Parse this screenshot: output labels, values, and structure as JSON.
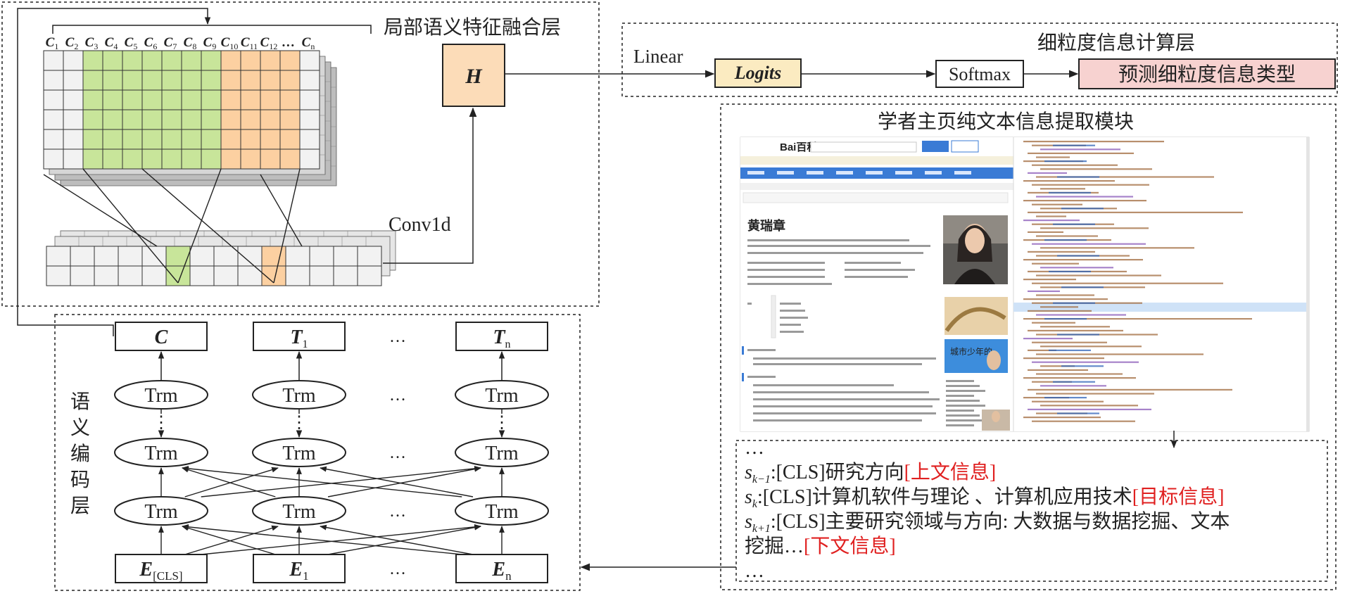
{
  "colors": {
    "green": "#c8e59a",
    "orange": "#fcd0a1",
    "logits_fill": "#fbebc1",
    "predict_fill": "#f7d2d0",
    "h_fill": "#fcdcb8",
    "red_text": "#e02020",
    "gray_cell": "#f2f2f2",
    "stack_gray": "#bdbdbd",
    "stack_gray2": "#d6d6d6",
    "screenshot_blue": "#3a7bd5"
  },
  "fusion": {
    "title": "局部语义特征融合层",
    "conv_label": "Conv1d",
    "h_label": "H",
    "columns": [
      {
        "main": "C",
        "sub": "1"
      },
      {
        "main": "C",
        "sub": "2"
      },
      {
        "main": "C",
        "sub": "3"
      },
      {
        "main": "C",
        "sub": "4"
      },
      {
        "main": "C",
        "sub": "5"
      },
      {
        "main": "C",
        "sub": "6"
      },
      {
        "main": "C",
        "sub": "7"
      },
      {
        "main": "C",
        "sub": "8"
      },
      {
        "main": "C",
        "sub": "9"
      },
      {
        "main": "C",
        "sub": "10"
      },
      {
        "main": "C",
        "sub": "11"
      },
      {
        "main": "C",
        "sub": "12"
      },
      {
        "main": "…",
        "sub": ""
      },
      {
        "main": "C",
        "sub": "n"
      }
    ]
  },
  "fine_grained": {
    "title": "细粒度信息计算层",
    "linear_label": "Linear",
    "logits_label": "Logits",
    "softmax_label": "Softmax",
    "predict_label": "预测细粒度信息类型"
  },
  "extract": {
    "title": "学者主页纯文本信息提取模块",
    "screenshot": {
      "logo": "Bai百科",
      "person_name": "黄瑞章",
      "side_caption": "城市少年的"
    },
    "text_lines": [
      {
        "type": "plain",
        "text": "…"
      },
      {
        "type": "seq",
        "s": "s",
        "sub": "k−1",
        "body": ":[CLS]研究方向",
        "tag": "[上文信息]"
      },
      {
        "type": "seq",
        "s": "s",
        "sub": "k",
        "body": ":[CLS]计算机软件与理论 、计算机应用技术",
        "tag": "[目标信息]"
      },
      {
        "type": "seq",
        "s": "s",
        "sub": "k+1",
        "body": ":[CLS]主要研究领域与方向: 大数据与数据挖掘、文本",
        "tag": ""
      },
      {
        "type": "cont",
        "body": "挖掘…",
        "tag": "[下文信息]"
      },
      {
        "type": "plain",
        "text": "…"
      }
    ]
  },
  "encoder": {
    "title_chars": [
      "语",
      "义",
      "编",
      "码",
      "层"
    ],
    "top_nodes": [
      {
        "main": "C",
        "sub": ""
      },
      {
        "main": "T",
        "sub": "1"
      },
      {
        "main": "T",
        "sub": "n"
      }
    ],
    "bottom_nodes": [
      {
        "main": "E",
        "sub": "[CLS]"
      },
      {
        "main": "E",
        "sub": "1"
      },
      {
        "main": "E",
        "sub": "n"
      }
    ],
    "trm_label": "Trm",
    "ellipsis": "…",
    "vdots": "⋮"
  }
}
